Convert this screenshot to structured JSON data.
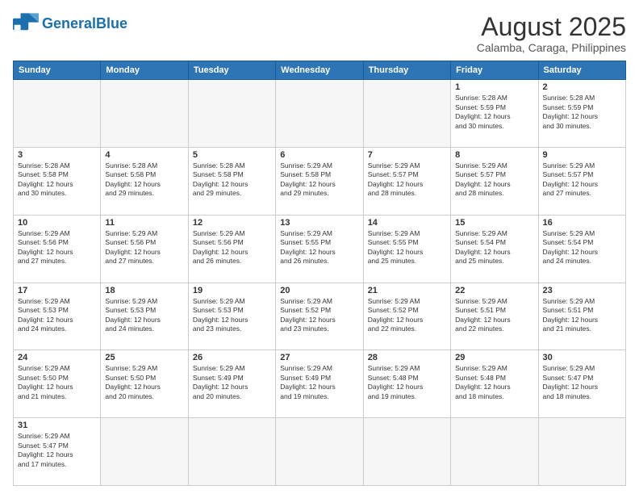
{
  "header": {
    "logo_general": "General",
    "logo_blue": "Blue",
    "title": "August 2025",
    "subtitle": "Calamba, Caraga, Philippines"
  },
  "days": [
    "Sunday",
    "Monday",
    "Tuesday",
    "Wednesday",
    "Thursday",
    "Friday",
    "Saturday"
  ],
  "weeks": [
    [
      {
        "date": "",
        "info": "",
        "empty": true
      },
      {
        "date": "",
        "info": "",
        "empty": true
      },
      {
        "date": "",
        "info": "",
        "empty": true
      },
      {
        "date": "",
        "info": "",
        "empty": true
      },
      {
        "date": "",
        "info": "",
        "empty": true
      },
      {
        "date": "1",
        "info": "Sunrise: 5:28 AM\nSunset: 5:59 PM\nDaylight: 12 hours\nand 30 minutes."
      },
      {
        "date": "2",
        "info": "Sunrise: 5:28 AM\nSunset: 5:59 PM\nDaylight: 12 hours\nand 30 minutes."
      }
    ],
    [
      {
        "date": "3",
        "info": "Sunrise: 5:28 AM\nSunset: 5:58 PM\nDaylight: 12 hours\nand 30 minutes."
      },
      {
        "date": "4",
        "info": "Sunrise: 5:28 AM\nSunset: 5:58 PM\nDaylight: 12 hours\nand 29 minutes."
      },
      {
        "date": "5",
        "info": "Sunrise: 5:28 AM\nSunset: 5:58 PM\nDaylight: 12 hours\nand 29 minutes."
      },
      {
        "date": "6",
        "info": "Sunrise: 5:29 AM\nSunset: 5:58 PM\nDaylight: 12 hours\nand 29 minutes."
      },
      {
        "date": "7",
        "info": "Sunrise: 5:29 AM\nSunset: 5:57 PM\nDaylight: 12 hours\nand 28 minutes."
      },
      {
        "date": "8",
        "info": "Sunrise: 5:29 AM\nSunset: 5:57 PM\nDaylight: 12 hours\nand 28 minutes."
      },
      {
        "date": "9",
        "info": "Sunrise: 5:29 AM\nSunset: 5:57 PM\nDaylight: 12 hours\nand 27 minutes."
      }
    ],
    [
      {
        "date": "10",
        "info": "Sunrise: 5:29 AM\nSunset: 5:56 PM\nDaylight: 12 hours\nand 27 minutes."
      },
      {
        "date": "11",
        "info": "Sunrise: 5:29 AM\nSunset: 5:56 PM\nDaylight: 12 hours\nand 27 minutes."
      },
      {
        "date": "12",
        "info": "Sunrise: 5:29 AM\nSunset: 5:56 PM\nDaylight: 12 hours\nand 26 minutes."
      },
      {
        "date": "13",
        "info": "Sunrise: 5:29 AM\nSunset: 5:55 PM\nDaylight: 12 hours\nand 26 minutes."
      },
      {
        "date": "14",
        "info": "Sunrise: 5:29 AM\nSunset: 5:55 PM\nDaylight: 12 hours\nand 25 minutes."
      },
      {
        "date": "15",
        "info": "Sunrise: 5:29 AM\nSunset: 5:54 PM\nDaylight: 12 hours\nand 25 minutes."
      },
      {
        "date": "16",
        "info": "Sunrise: 5:29 AM\nSunset: 5:54 PM\nDaylight: 12 hours\nand 24 minutes."
      }
    ],
    [
      {
        "date": "17",
        "info": "Sunrise: 5:29 AM\nSunset: 5:53 PM\nDaylight: 12 hours\nand 24 minutes."
      },
      {
        "date": "18",
        "info": "Sunrise: 5:29 AM\nSunset: 5:53 PM\nDaylight: 12 hours\nand 24 minutes."
      },
      {
        "date": "19",
        "info": "Sunrise: 5:29 AM\nSunset: 5:53 PM\nDaylight: 12 hours\nand 23 minutes."
      },
      {
        "date": "20",
        "info": "Sunrise: 5:29 AM\nSunset: 5:52 PM\nDaylight: 12 hours\nand 23 minutes."
      },
      {
        "date": "21",
        "info": "Sunrise: 5:29 AM\nSunset: 5:52 PM\nDaylight: 12 hours\nand 22 minutes."
      },
      {
        "date": "22",
        "info": "Sunrise: 5:29 AM\nSunset: 5:51 PM\nDaylight: 12 hours\nand 22 minutes."
      },
      {
        "date": "23",
        "info": "Sunrise: 5:29 AM\nSunset: 5:51 PM\nDaylight: 12 hours\nand 21 minutes."
      }
    ],
    [
      {
        "date": "24",
        "info": "Sunrise: 5:29 AM\nSunset: 5:50 PM\nDaylight: 12 hours\nand 21 minutes."
      },
      {
        "date": "25",
        "info": "Sunrise: 5:29 AM\nSunset: 5:50 PM\nDaylight: 12 hours\nand 20 minutes."
      },
      {
        "date": "26",
        "info": "Sunrise: 5:29 AM\nSunset: 5:49 PM\nDaylight: 12 hours\nand 20 minutes."
      },
      {
        "date": "27",
        "info": "Sunrise: 5:29 AM\nSunset: 5:49 PM\nDaylight: 12 hours\nand 19 minutes."
      },
      {
        "date": "28",
        "info": "Sunrise: 5:29 AM\nSunset: 5:48 PM\nDaylight: 12 hours\nand 19 minutes."
      },
      {
        "date": "29",
        "info": "Sunrise: 5:29 AM\nSunset: 5:48 PM\nDaylight: 12 hours\nand 18 minutes."
      },
      {
        "date": "30",
        "info": "Sunrise: 5:29 AM\nSunset: 5:47 PM\nDaylight: 12 hours\nand 18 minutes."
      }
    ],
    [
      {
        "date": "31",
        "info": "Sunrise: 5:29 AM\nSunset: 5:47 PM\nDaylight: 12 hours\nand 17 minutes."
      },
      {
        "date": "",
        "info": "",
        "empty": true
      },
      {
        "date": "",
        "info": "",
        "empty": true
      },
      {
        "date": "",
        "info": "",
        "empty": true
      },
      {
        "date": "",
        "info": "",
        "empty": true
      },
      {
        "date": "",
        "info": "",
        "empty": true
      },
      {
        "date": "",
        "info": "",
        "empty": true
      }
    ]
  ]
}
